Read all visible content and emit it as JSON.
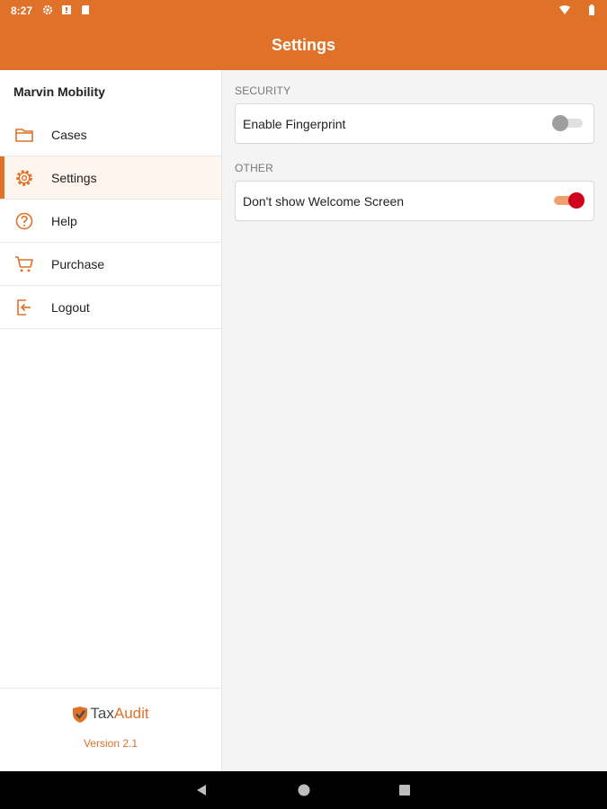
{
  "status_bar": {
    "time": "8:27",
    "icons": [
      "gear-icon",
      "alert-icon",
      "sd-card-icon",
      "wifi-icon",
      "battery-icon"
    ]
  },
  "app_bar": {
    "title": "Settings"
  },
  "sidebar": {
    "user_name": "Marvin Mobility",
    "items": [
      {
        "label": "Cases",
        "icon": "folder-icon",
        "active": false
      },
      {
        "label": "Settings",
        "icon": "gear-icon",
        "active": true
      },
      {
        "label": "Help",
        "icon": "help-icon",
        "active": false
      },
      {
        "label": "Purchase",
        "icon": "cart-icon",
        "active": false
      },
      {
        "label": "Logout",
        "icon": "logout-icon",
        "active": false
      }
    ],
    "brand_tax": "Tax",
    "brand_audit": "Audit",
    "version": "Version 2.1"
  },
  "settings": {
    "security_header": "SECURITY",
    "fingerprint_label": "Enable Fingerprint",
    "fingerprint_enabled": false,
    "other_header": "OTHER",
    "welcome_label": "Don't show Welcome Screen",
    "welcome_enabled": true
  },
  "colors": {
    "accent": "#e07128",
    "toggle_on_thumb": "#d0021b",
    "toggle_off_thumb": "#9e9e9e"
  },
  "nav_bar": {
    "buttons": [
      "back-icon",
      "home-icon",
      "recents-icon"
    ]
  }
}
